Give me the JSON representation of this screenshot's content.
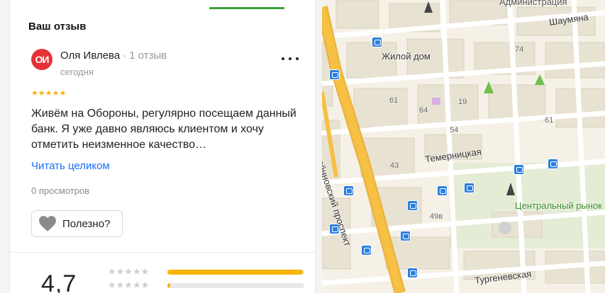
{
  "review": {
    "section_title": "Ваш отзыв",
    "avatar_initials": "ОИ",
    "author_name": "Оля Ивлева",
    "separator": "·",
    "author_reviews_count": "1 отзыв",
    "date": "сегодня",
    "rating_stars": "★★★★★",
    "rating_value": 5,
    "text": "Живём на Обороны, регулярно посещаем данный банк. Я уже давно являюсь клиентом и хочу отметить неизменное качество…",
    "read_more": "Читать целиком",
    "views": "0 просмотров",
    "helpful_label": "Полезно?",
    "more_icon": "more-horizontal-icon",
    "helpful_icon": "heart-icon"
  },
  "rating_summary": {
    "overall": "4,7",
    "distribution": [
      {
        "stars": "★★★★★",
        "share": 0.99
      },
      {
        "stars": "★★★★★",
        "share": 0.02
      }
    ]
  },
  "map": {
    "labels": {
      "administration": "Администрация",
      "shaumyana": "Шаумяна",
      "zhiloy_dom": "Жилой дом",
      "temernitskaya": "Темерницкая",
      "budennovsky": "Будённовский проспект",
      "central_market": "Центральный рынок",
      "turgenevskaya": "Тургеневская"
    },
    "house_numbers": [
      "74",
      "61",
      "64",
      "19",
      "54",
      "43",
      "49в",
      "61"
    ]
  },
  "colors": {
    "accent_link": "#196dff",
    "star": "#f4b515",
    "tab_active": "#3ca03c",
    "avatar_bg": "#e53238",
    "bar_fill": "#f8b400",
    "main_road": "#f6c044",
    "transit_stop": "#2d7fe0"
  }
}
